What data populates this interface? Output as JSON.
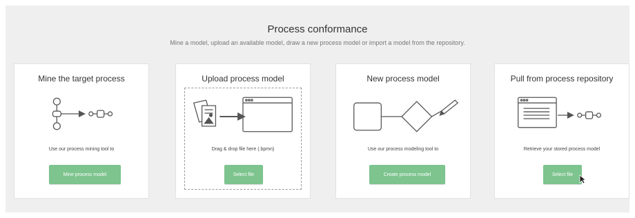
{
  "header": {
    "title": "Process conformance",
    "subtitle": "Mine a model, upload an available model, draw a new process model or import a model from the repository."
  },
  "cards": [
    {
      "title": "Mine the target process",
      "description": "Use our process mining tool to",
      "button_label": "Mine process model",
      "icon": "process-mining-icon"
    },
    {
      "title": "Upload process model",
      "description": "Drag & drop file here (.bpmn)",
      "button_label": "Select file",
      "icon": "upload-files-icon"
    },
    {
      "title": "New process model",
      "description": "Use our process modeling tool to",
      "button_label": "Create process model",
      "icon": "process-draw-icon"
    },
    {
      "title": "Pull from process repository",
      "description": "Retrieve your stored process model",
      "button_label": "Select file",
      "icon": "repository-icon"
    }
  ],
  "colors": {
    "button": "#7dc48e",
    "panel_bg": "#efefef",
    "icon_stroke": "#555555"
  }
}
